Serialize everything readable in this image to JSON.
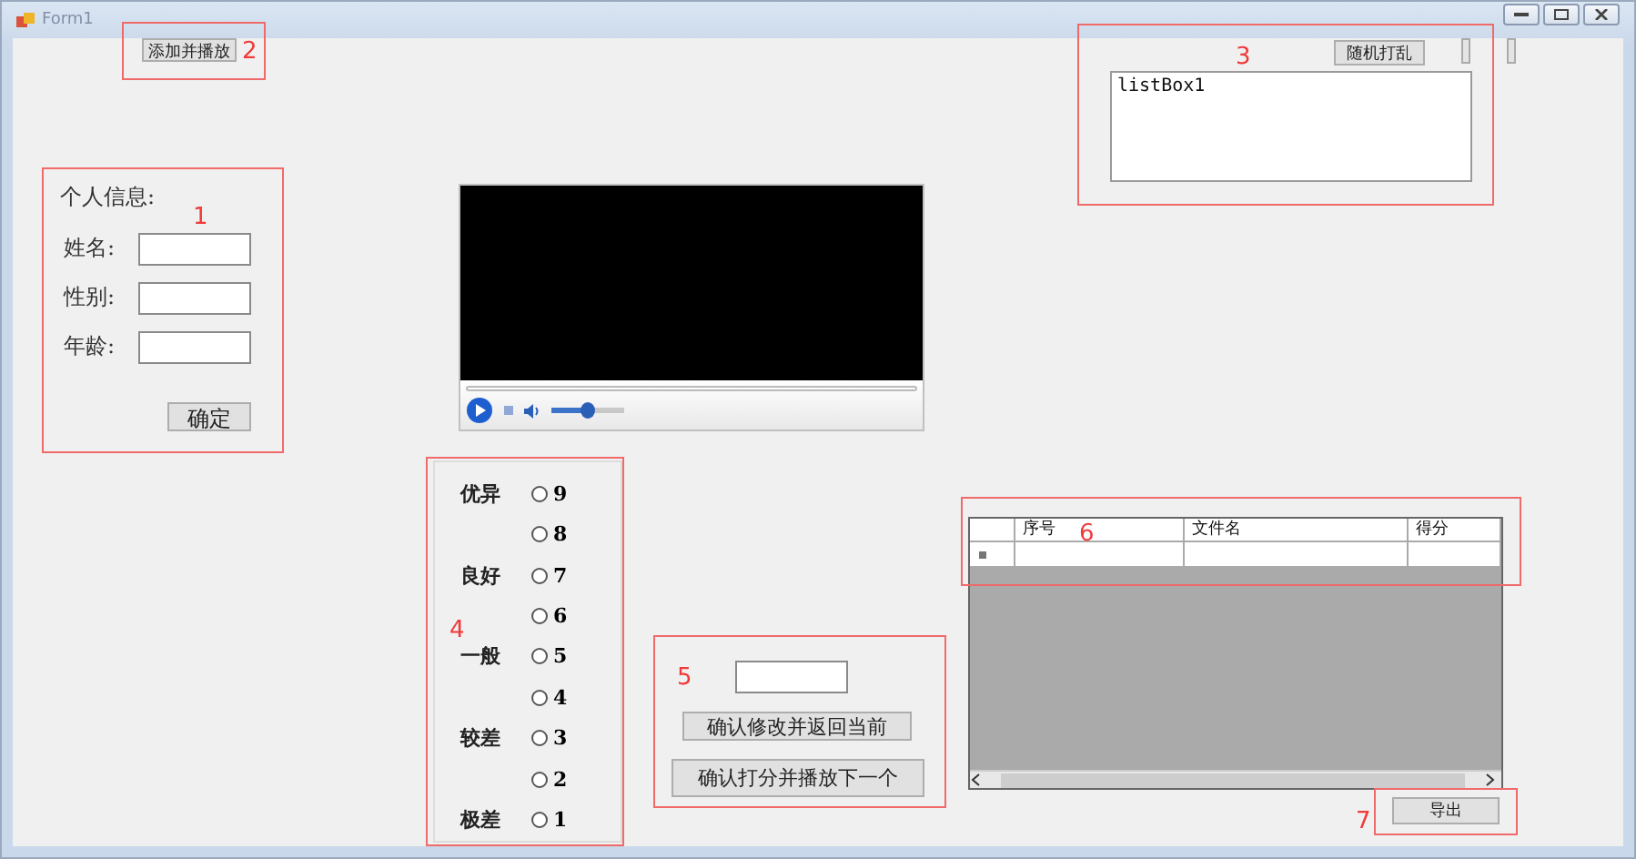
{
  "window": {
    "title": "Form1"
  },
  "add_play": {
    "annotation": "2",
    "button": "添加并播放"
  },
  "shuffle": {
    "annotation": "3",
    "button": "随机打乱",
    "listbox_items": [
      "listBox1"
    ]
  },
  "personal_info": {
    "annotation": "1",
    "heading": "个人信息:",
    "fields": [
      {
        "label": "姓名:"
      },
      {
        "label": "性别:"
      },
      {
        "label": "年龄:"
      }
    ],
    "confirm_button": "确定"
  },
  "media_player": {
    "volume": {
      "level": 0.5
    }
  },
  "rating": {
    "annotation": "4",
    "grades": [
      "优异",
      "良好",
      "一般",
      "较差",
      "极差"
    ],
    "scores": [
      {
        "label": "9",
        "selected": false
      },
      {
        "label": "8",
        "selected": false
      },
      {
        "label": "7",
        "selected": false
      },
      {
        "label": "6",
        "selected": false
      },
      {
        "label": "5",
        "selected": false
      },
      {
        "label": "4",
        "selected": false
      },
      {
        "label": "3",
        "selected": false
      },
      {
        "label": "2",
        "selected": false
      },
      {
        "label": "1",
        "selected": false
      }
    ]
  },
  "score_edit": {
    "annotation": "5",
    "buttons": [
      "确认修改并返回当前",
      "确认打分并播放下一个"
    ]
  },
  "grid": {
    "annotation": "6",
    "columns": [
      "序号",
      "文件名",
      "得分"
    ]
  },
  "export": {
    "annotation": "7",
    "button": "导出"
  }
}
